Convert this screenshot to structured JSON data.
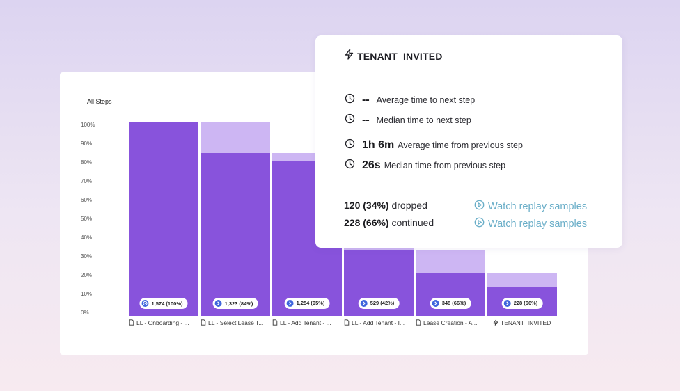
{
  "chart": {
    "title": "All Steps",
    "y_ticks": [
      "100%",
      "90%",
      "80%",
      "70%",
      "60%",
      "50%",
      "40%",
      "30%",
      "20%",
      "10%",
      "0%"
    ],
    "steps": [
      {
        "label": "LL - Onboarding - ...",
        "badge": "1,574 (100%)",
        "icon": "target-icon",
        "step_icon": "document-icon",
        "total_pct": 100,
        "continued_pct": 100
      },
      {
        "label": "LL - Select Lease T...",
        "badge": "1,323 (84%)",
        "icon": "chevron-right-icon",
        "step_icon": "document-icon",
        "total_pct": 100,
        "continued_pct": 84
      },
      {
        "label": "LL - Add Tenant - ...",
        "badge": "1,254 (95%)",
        "icon": "chevron-right-icon",
        "step_icon": "document-icon",
        "total_pct": 84,
        "continued_pct": 80
      },
      {
        "label": "LL - Add Tenant - I...",
        "badge": "529 (42%)",
        "icon": "chevron-right-icon",
        "step_icon": "document-icon",
        "total_pct": 36,
        "continued_pct": 34
      },
      {
        "label": "Lease Creation - A...",
        "badge": "348 (66%)",
        "icon": "chevron-right-icon",
        "step_icon": "document-icon",
        "total_pct": 34,
        "continued_pct": 22
      },
      {
        "label": "TENANT_INVITED",
        "badge": "228 (66%)",
        "icon": "chevron-right-icon",
        "step_icon": "lightning-icon",
        "total_pct": 22,
        "continued_pct": 15
      }
    ],
    "colors": {
      "continued": "#8853dc",
      "dropped": "#cdb6f3",
      "badge_icon": "#3f66dd"
    }
  },
  "detail": {
    "title": "TENANT_INVITED",
    "title_icon": "lightning-icon",
    "stats": [
      {
        "value": "--",
        "label": "Average time to next step"
      },
      {
        "value": "--",
        "label": "Median time to next step"
      },
      {
        "value": "1h 6m",
        "label": "Average time from previous step"
      },
      {
        "value": "26s",
        "label": "Median time from previous step"
      }
    ],
    "dropped": {
      "count": "120 (34%)",
      "label": "dropped"
    },
    "continued": {
      "count": "228 (66%)",
      "label": "continued"
    },
    "replay_label": "Watch replay samples",
    "link_color": "#6aaec8"
  }
}
